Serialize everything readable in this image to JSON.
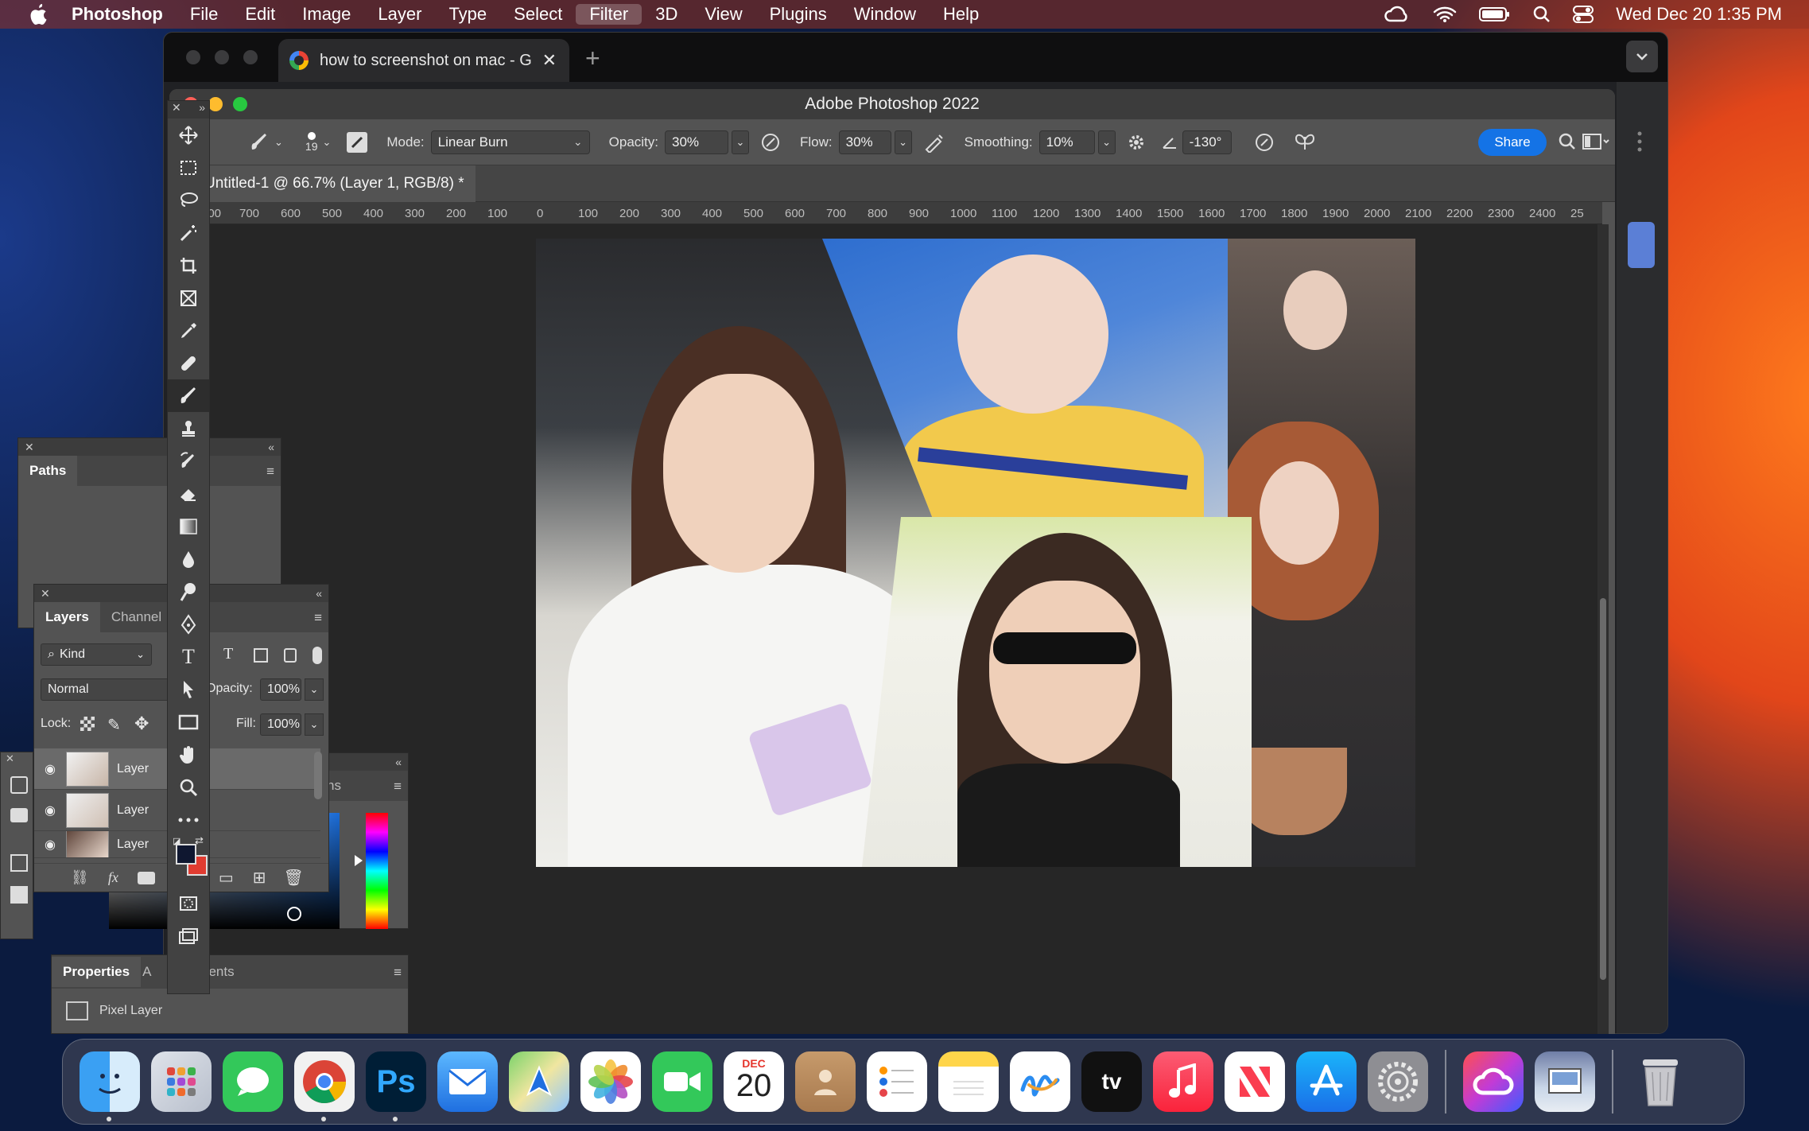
{
  "menubar": {
    "app": "Photoshop",
    "items": [
      "File",
      "Edit",
      "Image",
      "Layer",
      "Type",
      "Select",
      "Filter",
      "3D",
      "View",
      "Plugins",
      "Window",
      "Help"
    ],
    "active": "Filter",
    "datetime": "Wed Dec 20  1:35 PM"
  },
  "browser": {
    "tab_title": "how to screenshot on mac - G",
    "new_tab": "+",
    "tab_close": "✕"
  },
  "photoshop": {
    "window_title": "Adobe Photoshop 2022",
    "options": {
      "brush_size": "19",
      "mode_label": "Mode:",
      "mode_value": "Linear Burn",
      "opacity_label": "Opacity:",
      "opacity_value": "30%",
      "flow_label": "Flow:",
      "flow_value": "30%",
      "smoothing_label": "Smoothing:",
      "smoothing_value": "10%",
      "angle_value": "-130°",
      "share_label": "Share"
    },
    "document_tab": "Untitled-1 @ 66.7% (Layer 1, RGB/8) *",
    "ruler_ticks": [
      "700",
      "700",
      "600",
      "500",
      "400",
      "300",
      "200",
      "100",
      "0",
      "100",
      "200",
      "300",
      "400",
      "500",
      "600",
      "700",
      "800",
      "900",
      "1000",
      "1100",
      "1200",
      "1300",
      "1400",
      "1500",
      "1600",
      "1700",
      "1800",
      "1900",
      "2000",
      "2100",
      "2200",
      "2300",
      "2400",
      "25"
    ]
  },
  "panels": {
    "paths_tab": "Paths",
    "layers_tab": "Layers",
    "channels_tab": "Channel",
    "filter_kind": "Kind",
    "blend_mode": "Normal",
    "opacity_label": "Opacity:",
    "opacity_value": "100%",
    "lock_label": "Lock:",
    "fill_label": "Fill:",
    "fill_value": "100%",
    "layers": [
      "Layer",
      "Layer",
      "Layer"
    ],
    "fx_label": "fx",
    "adjust_tab_fragment": "ns",
    "properties_tab": "Properties",
    "adjustments_tab_fragment": "A",
    "adjustments_tab_suffix": "ents",
    "pixel_layer": "Pixel Layer"
  },
  "dock": {
    "calendar_month": "DEC",
    "calendar_day": "20",
    "ps_label": "Ps",
    "tv_label": "tv"
  },
  "colors": {
    "accent": "#1473e6",
    "foreground": "#0f1730",
    "background": "#e03c31"
  }
}
